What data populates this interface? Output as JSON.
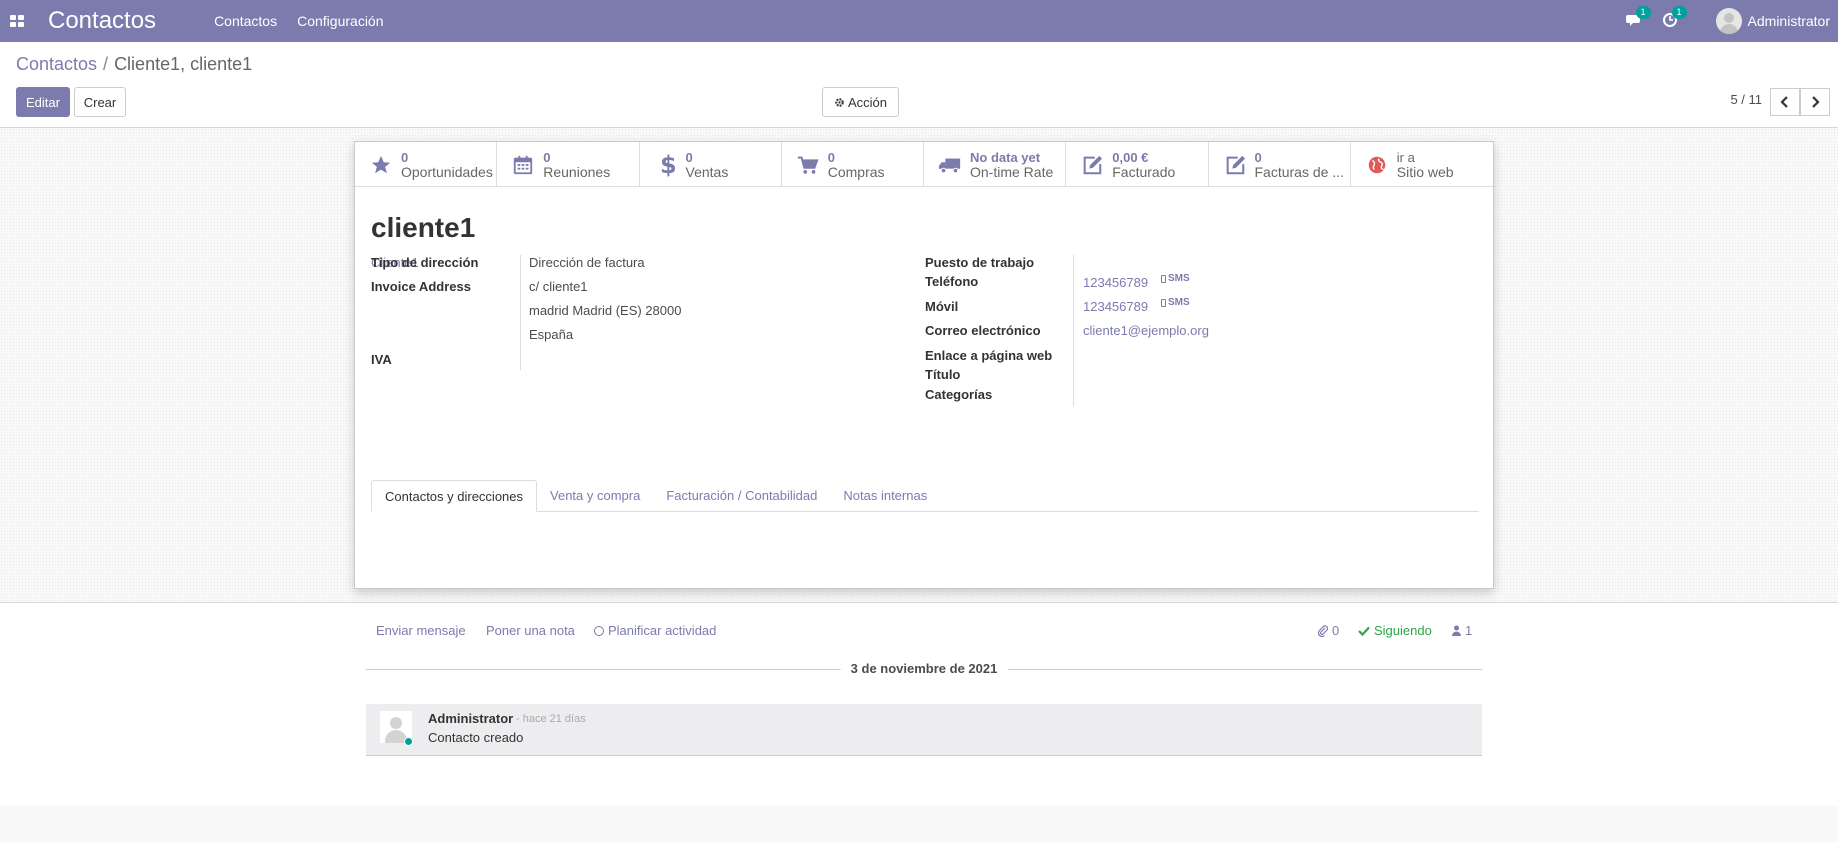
{
  "navbar": {
    "brand": "Contactos",
    "menus": [
      "Contactos",
      "Configuración"
    ],
    "messages_badge": "1",
    "activities_badge": "1",
    "user": "Administrator"
  },
  "breadcrumb": {
    "parent": "Contactos",
    "separator": "/",
    "current": "Cliente1, cliente1"
  },
  "buttons": {
    "edit": "Editar",
    "create": "Crear",
    "action": "Acción"
  },
  "pager": {
    "value": "5 / 11"
  },
  "stat_buttons": [
    {
      "value": "0",
      "label": "Oportunidades",
      "icon": "star-icon"
    },
    {
      "value": "0",
      "label": "Reuniones",
      "icon": "calendar-icon"
    },
    {
      "value": "0",
      "label": "Ventas",
      "icon": "dollar-icon"
    },
    {
      "value": "0",
      "label": "Compras",
      "icon": "cart-icon"
    },
    {
      "value": "No data yet",
      "label": "On-time Rate",
      "icon": "truck-icon"
    },
    {
      "value": "0,00 €",
      "label": "Facturado",
      "icon": "edit-icon"
    },
    {
      "value": "0",
      "label": "Facturas de ...",
      "icon": "edit-icon"
    },
    {
      "value": "ir a",
      "label": "Sitio web",
      "icon": "globe-icon"
    }
  ],
  "record": {
    "name": "cliente1",
    "parent_company": "Cliente1"
  },
  "left_fields": {
    "address_type_label": "Tipo de dirección",
    "address_type_value": "Dirección de factura",
    "invoice_address_label": "Invoice Address",
    "street": "c/ cliente1",
    "city_line": "madrid  Madrid (ES)  28000",
    "country": "España",
    "vat_label": "IVA"
  },
  "right_fields": {
    "job_label": "Puesto de trabajo",
    "phone_label": "Teléfono",
    "phone_value": "123456789",
    "mobile_label": "Móvil",
    "mobile_value": "123456789",
    "email_label": "Correo electrónico",
    "email_value": "cliente1@ejemplo.org",
    "website_label": "Enlace a página web",
    "title_label": "Título",
    "categories_label": "Categorías",
    "sms_label": "SMS"
  },
  "tabs": [
    "Contactos y direcciones",
    "Venta y compra",
    "Facturación / Contabilidad",
    "Notas internas"
  ],
  "chatter": {
    "send_message": "Enviar mensaje",
    "log_note": "Poner una nota",
    "schedule_activity": "Planificar actividad",
    "attachments_count": "0",
    "following": "Siguiendo",
    "followers_count": "1",
    "date_separator": "3 de noviembre de 2021",
    "message": {
      "author": "Administrator",
      "date": "- hace 21 días",
      "body": "Contacto creado"
    }
  },
  "colors": {
    "brand": "#7c7bad",
    "success": "#28a745",
    "online": "#00a09d"
  }
}
